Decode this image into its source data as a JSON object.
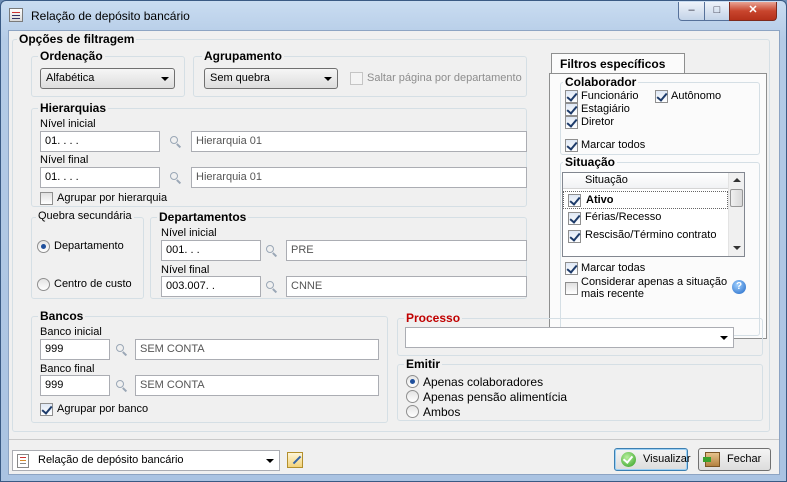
{
  "window": {
    "title": "Relação de depósito bancário",
    "buttons": {
      "minimize": "–",
      "maximize": "□",
      "close": "✕"
    }
  },
  "filtragem": {
    "title": "Opções de filtragem",
    "ordenacao": {
      "label": "Ordenação",
      "value": "Alfabética"
    },
    "agrupamento": {
      "label": "Agrupamento",
      "value": "Sem quebra",
      "saltar_label": "Saltar página por departamento"
    },
    "hierarquias": {
      "label": "Hierarquias",
      "nivel_inicial_label": "Nível inicial",
      "nivel_inicial_value": "01.   .   .   .",
      "nivel_inicial_desc": "Hierarquia 01",
      "nivel_final_label": "Nível final",
      "nivel_final_value": "01.   .   .   .",
      "nivel_final_desc": "Hierarquia 01",
      "agrupar_label": "Agrupar por hierarquia"
    },
    "quebra": {
      "label": "Quebra secundária",
      "departamento": "Departamento",
      "centro_custo": "Centro de custo"
    },
    "departamentos": {
      "label": "Departamentos",
      "nivel_inicial_label": "Nível inicial",
      "nivel_inicial_value": "001.   .   .",
      "nivel_inicial_desc": "PRE",
      "nivel_final_label": "Nível final",
      "nivel_final_value": "003.007.   .",
      "nivel_final_desc": "CNNE"
    },
    "bancos": {
      "label": "Bancos",
      "inicial_label": "Banco inicial",
      "inicial_value": "999",
      "inicial_desc": "SEM CONTA",
      "final_label": "Banco final",
      "final_value": "999",
      "final_desc": "SEM CONTA",
      "agrupar_label": "Agrupar por banco"
    },
    "processo": {
      "label": "Processo",
      "value": ""
    },
    "emitir": {
      "label": "Emitir",
      "options": [
        "Apenas colaboradores",
        "Apenas pensão alimentícia",
        "Ambos"
      ]
    }
  },
  "filtros": {
    "tab_label": "Filtros específicos",
    "colaborador": {
      "label": "Colaborador",
      "funcionario": "Funcionário",
      "autonomo": "Autônomo",
      "estagiario": "Estagiário",
      "diretor": "Diretor",
      "marcar_todos": "Marcar todos"
    },
    "situacao": {
      "label": "Situação",
      "column": "Situação",
      "rows": [
        "Ativo",
        "Férias/Recesso",
        "Rescisão/Término contrato"
      ],
      "marcar_todas": "Marcar todas",
      "considerar_line1": "Considerar apenas a situação",
      "considerar_line2": "mais recente",
      "help": "?"
    }
  },
  "footer": {
    "report_select": "Relação de depósito bancário",
    "visualizar": "Visualizar",
    "fechar": "Fechar"
  }
}
